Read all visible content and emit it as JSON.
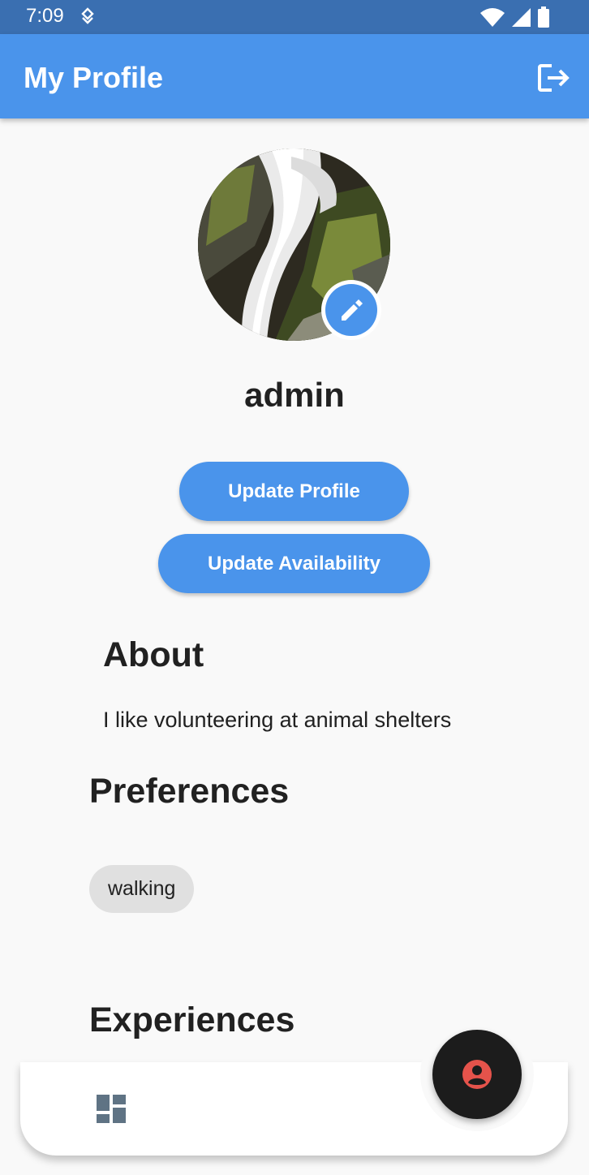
{
  "status_bar": {
    "time": "7:09"
  },
  "app_bar": {
    "title": "My Profile"
  },
  "profile": {
    "username": "admin"
  },
  "buttons": {
    "update_profile": "Update Profile",
    "update_availability": "Update Availability"
  },
  "about": {
    "title": "About",
    "text": "I like volunteering at animal shelters"
  },
  "preferences": {
    "title": "Preferences",
    "chips": [
      "walking"
    ]
  },
  "experiences": {
    "title": "Experiences"
  },
  "icons": {
    "logout": "logout-icon",
    "edit": "pencil-icon",
    "dashboard": "dashboard-icon",
    "profile": "account-circle-icon"
  },
  "colors": {
    "primary": "#4a94eb",
    "status_bar": "#3a6fb1",
    "fab": "#1c1c1c",
    "fab_icon": "#e5534b",
    "nav_icon": "#5f7384"
  }
}
